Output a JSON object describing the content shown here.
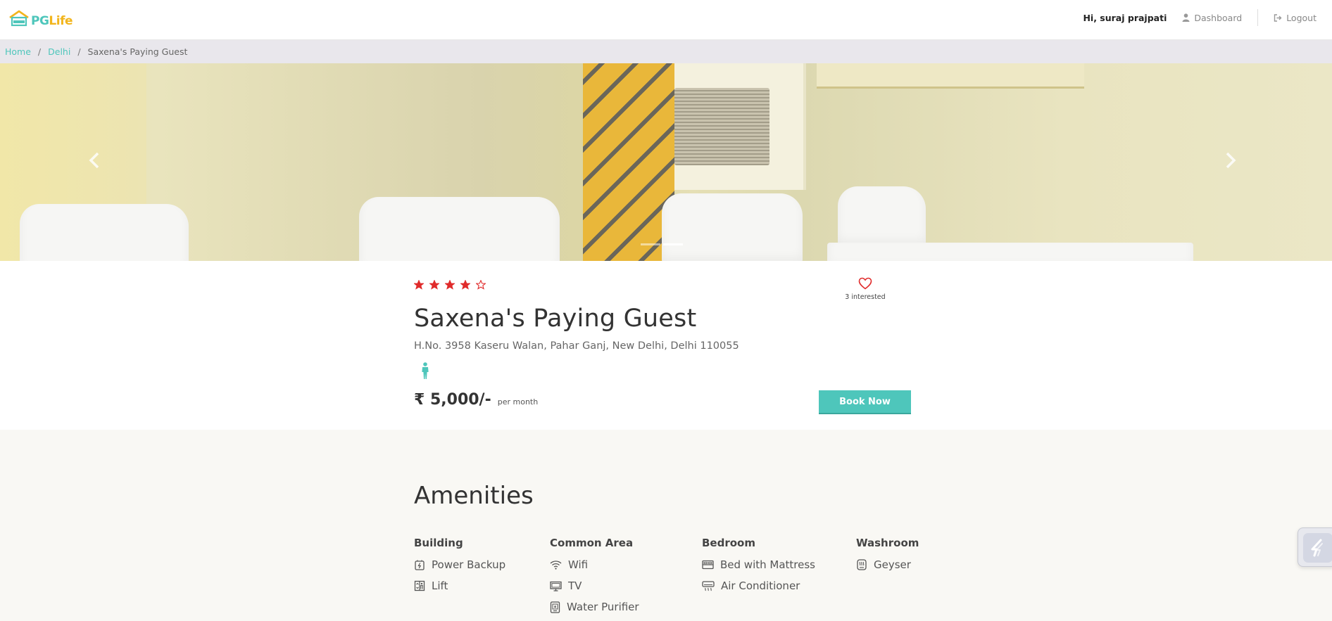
{
  "brand": {
    "pg": "PG",
    "life": "Life"
  },
  "nav": {
    "greeting": "Hi, suraj prajpati",
    "dashboard": "Dashboard",
    "logout": "Logout"
  },
  "breadcrumb": {
    "items": [
      "Home",
      "Delhi"
    ],
    "separator": "/",
    "current": "Saxena's Paying Guest"
  },
  "carousel": {
    "slide_count": 2,
    "active_slide": 2
  },
  "property": {
    "rating": 4,
    "rating_max": 5,
    "interested_count": "3 interested",
    "name": "Saxena's Paying Guest",
    "address": "H.No. 3958 Kaseru Walan, Pahar Ganj, New Delhi, Delhi 110055",
    "gender_icon": "male-icon",
    "price": "₹ 5,000/-",
    "price_period": "per month",
    "book_label": "Book Now"
  },
  "amenities": {
    "title": "Amenities",
    "groups": [
      {
        "name": "Building",
        "items": [
          {
            "label": "Power Backup",
            "icon": "power-backup-icon"
          },
          {
            "label": "Lift",
            "icon": "lift-icon"
          }
        ]
      },
      {
        "name": "Common Area",
        "items": [
          {
            "label": "Wifi",
            "icon": "wifi-icon"
          },
          {
            "label": "TV",
            "icon": "tv-icon"
          },
          {
            "label": "Water Purifier",
            "icon": "water-purifier-icon"
          }
        ]
      },
      {
        "name": "Bedroom",
        "items": [
          {
            "label": "Bed with Mattress",
            "icon": "bed-icon"
          },
          {
            "label": "Air Conditioner",
            "icon": "air-conditioner-icon"
          }
        ]
      },
      {
        "name": "Washroom",
        "items": [
          {
            "label": "Geyser",
            "icon": "geyser-icon"
          }
        ]
      }
    ]
  },
  "colors": {
    "accent": "#4ec6bb",
    "brand_yellow": "#f2b51d",
    "star": "#e02b2b",
    "heart": "#e02b2b"
  }
}
